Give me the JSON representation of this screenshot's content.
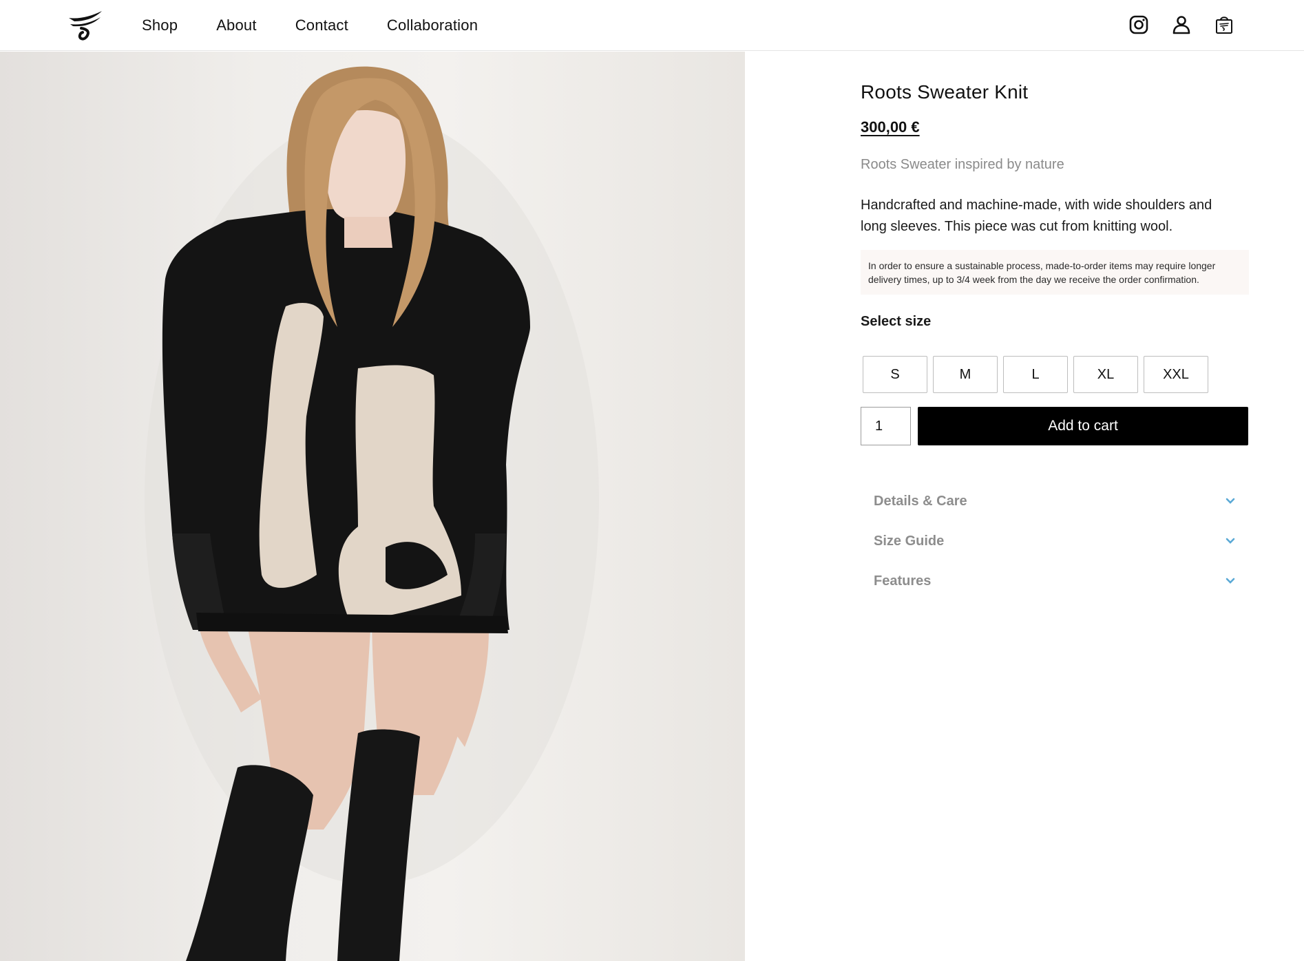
{
  "nav": {
    "items": [
      "Shop",
      "About",
      "Contact",
      "Collaboration"
    ]
  },
  "header_icons": [
    "instagram-icon",
    "account-icon",
    "cart-icon"
  ],
  "product": {
    "title": "Roots Sweater Knit",
    "price": "300,00 €",
    "subtitle": "Roots Sweater inspired by nature",
    "description": "Handcrafted and machine-made, with wide shoulders and long sleeves. This piece was cut from knitting wool.",
    "notice": "In order to ensure a sustainable process, made-to-order items may require longer delivery times, up to 3/4 week from the day we receive the order confirmation."
  },
  "size_selector": {
    "label": "Select size",
    "options": [
      "S",
      "M",
      "L",
      "XL",
      "XXL"
    ]
  },
  "purchase": {
    "quantity": "1",
    "add_to_cart_label": "Add to cart"
  },
  "accordion": [
    "Details & Care",
    "Size Guide",
    "Features"
  ],
  "colors": {
    "accent_chevron": "#5aa9d6",
    "button_bg": "#000000",
    "notice_bg": "#fbf7f5"
  }
}
